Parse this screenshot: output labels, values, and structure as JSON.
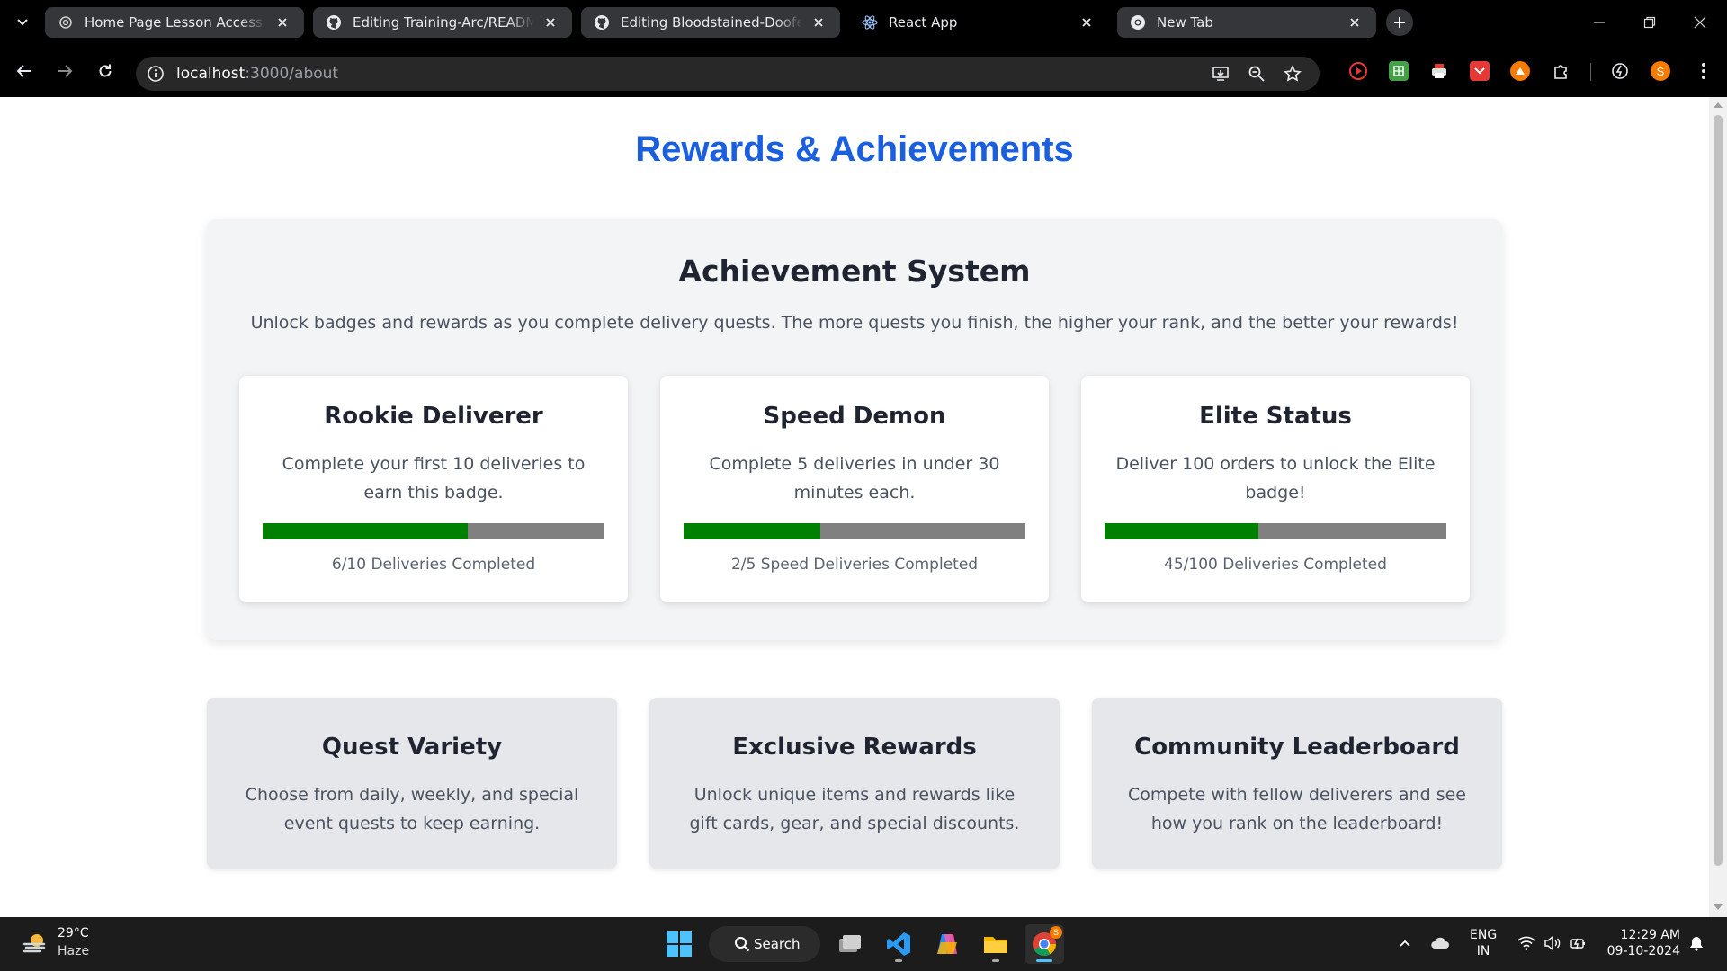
{
  "browser": {
    "tabs": [
      {
        "title": "Home Page Lesson Access",
        "icon": "openai-icon",
        "active": false
      },
      {
        "title": "Editing Training-Arc/README.md",
        "icon": "github-icon",
        "active": false
      },
      {
        "title": "Editing Bloodstained-Doofestien",
        "icon": "github-icon",
        "active": false
      },
      {
        "title": "React App",
        "icon": "react-icon",
        "active": true
      },
      {
        "title": "New Tab",
        "icon": "chrome-icon",
        "active": false
      }
    ],
    "url_host": "localhost",
    "url_rest": ":3000/about",
    "profile_initial": "S"
  },
  "page": {
    "title": "Rewards & Achievements",
    "achievements": {
      "heading": "Achievement System",
      "description": "Unlock badges and rewards as you complete delivery quests. The more quests you finish, the higher your rank, and the better your rewards!",
      "badges": [
        {
          "name": "Rookie Deliverer",
          "description": "Complete your first 10 deliveries to earn this badge.",
          "progress_label": "6/10 Deliveries Completed",
          "progress": 0.6
        },
        {
          "name": "Speed Demon",
          "description": "Complete 5 deliveries in under 30 minutes each.",
          "progress_label": "2/5 Speed Deliveries Completed",
          "progress": 0.4
        },
        {
          "name": "Elite Status",
          "description": "Deliver 100 orders to unlock the Elite badge!",
          "progress_label": "45/100 Deliveries Completed",
          "progress": 0.45
        }
      ]
    },
    "features": [
      {
        "title": "Quest Variety",
        "description": "Choose from daily, weekly, and special event quests to keep earning."
      },
      {
        "title": "Exclusive Rewards",
        "description": "Unlock unique items and rewards like gift cards, gear, and special discounts."
      },
      {
        "title": "Community Leaderboard",
        "description": "Compete with fellow deliverers and see how you rank on the leaderboard!"
      }
    ]
  },
  "colors": {
    "title_blue": "#1a5fe0",
    "progress_fill": "#008000",
    "progress_track": "#808080"
  },
  "taskbar": {
    "temperature": "29°C",
    "condition": "Haze",
    "search_label": "Search",
    "lang_top": "ENG",
    "lang_bottom": "IN",
    "time": "12:29 AM",
    "date": "09-10-2024",
    "chrome_badge": "S"
  }
}
